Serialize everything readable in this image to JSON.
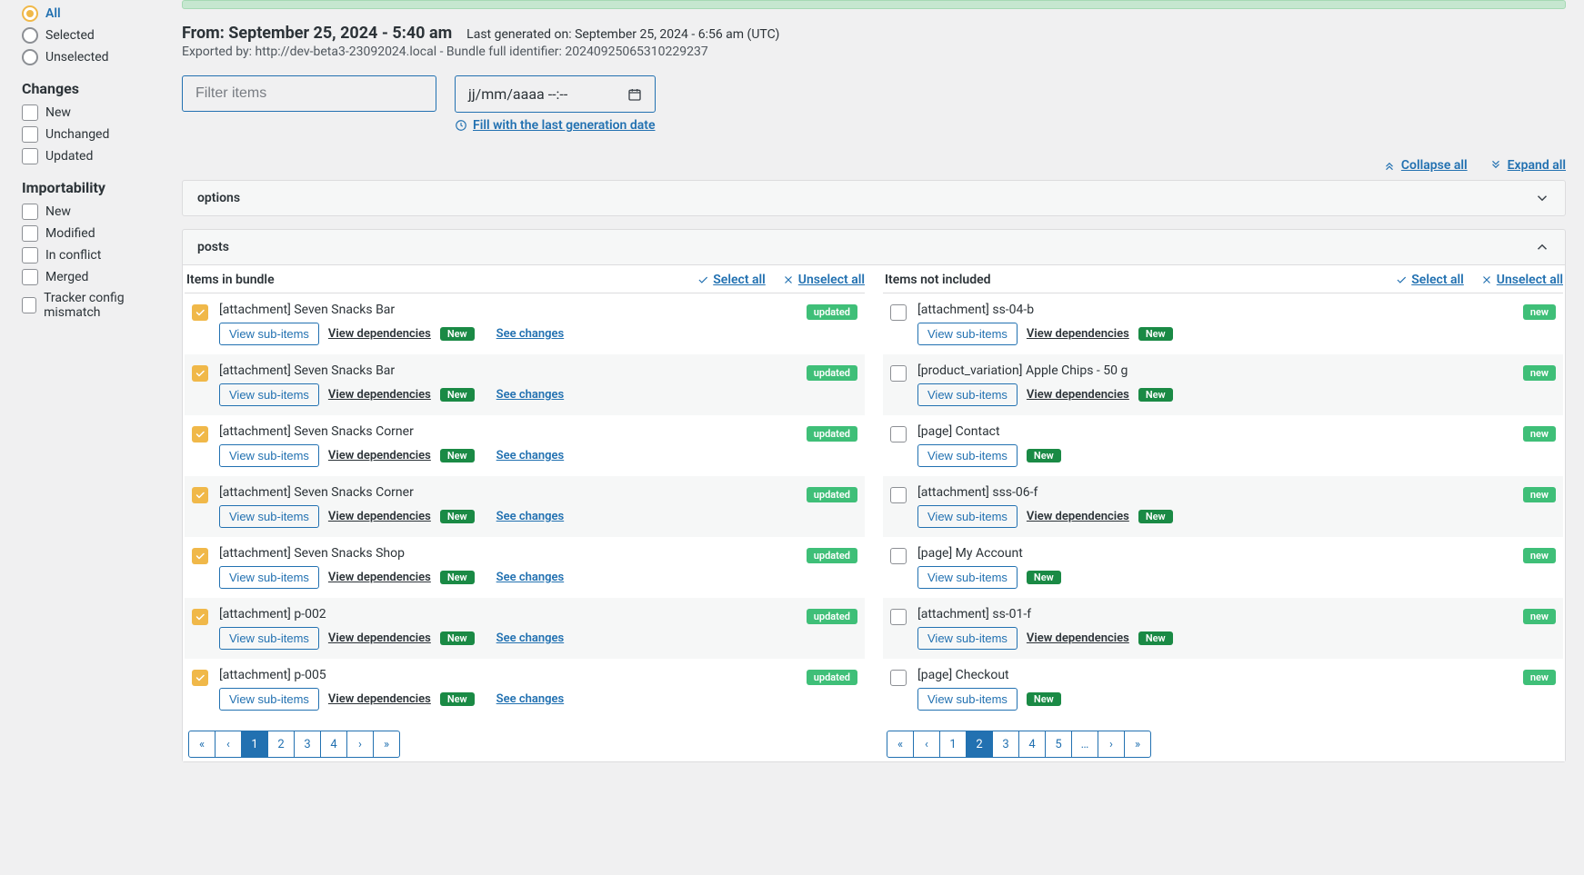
{
  "sidebar": {
    "selection_heading_hidden": true,
    "selection": {
      "options": [
        {
          "label": "All",
          "selected": true
        },
        {
          "label": "Selected",
          "selected": false
        },
        {
          "label": "Unselected",
          "selected": false
        }
      ]
    },
    "changes": {
      "heading": "Changes",
      "options": [
        "New",
        "Unchanged",
        "Updated"
      ]
    },
    "importability": {
      "heading": "Importability",
      "options": [
        "New",
        "Modified",
        "In conflict",
        "Merged",
        "Tracker config mismatch"
      ]
    }
  },
  "meta": {
    "from_label": "From: September 25, 2024 - 5:40 am",
    "lastgen": "Last generated on: September 25, 2024 - 6:56 am (UTC)",
    "exported": "Exported by: http://dev-beta3-23092024.local - Bundle full identifier: 20240925065310229237"
  },
  "filters": {
    "filter_placeholder": "Filter items",
    "date_placeholder": "jj/mm/aaaa --:--",
    "fill_link": "Fill with the last generation date"
  },
  "toolbar": {
    "collapse": "Collapse all",
    "expand": "Expand all"
  },
  "panels": {
    "options": {
      "title": "options"
    },
    "posts": {
      "title": "posts"
    }
  },
  "labels": {
    "items_in_bundle": "Items in bundle",
    "items_not_included": "Items not included",
    "select_all": "Select all",
    "unselect_all": "Unselect all",
    "view_sub": "View sub-items",
    "view_deps": "View dependencies",
    "see_changes": "See changes",
    "new": "New",
    "updated": "updated",
    "new_badge": "new"
  },
  "left_items": [
    {
      "title": "[attachment] Seven Snacks Bar",
      "checked": true,
      "status": "updated",
      "deps": true,
      "changes": true
    },
    {
      "title": "[attachment] Seven Snacks Bar",
      "checked": true,
      "status": "updated",
      "deps": true,
      "changes": true
    },
    {
      "title": "[attachment] Seven Snacks Corner",
      "checked": true,
      "status": "updated",
      "deps": true,
      "changes": true
    },
    {
      "title": "[attachment] Seven Snacks Corner",
      "checked": true,
      "status": "updated",
      "deps": true,
      "changes": true
    },
    {
      "title": "[attachment] Seven Snacks Shop",
      "checked": true,
      "status": "updated",
      "deps": true,
      "changes": true
    },
    {
      "title": "[attachment] p-002",
      "checked": true,
      "status": "updated",
      "deps": true,
      "changes": true
    },
    {
      "title": "[attachment] p-005",
      "checked": true,
      "status": "updated",
      "deps": true,
      "changes": true
    }
  ],
  "right_items": [
    {
      "title": "[attachment] ss-04-b",
      "checked": false,
      "status": "new",
      "deps": true,
      "changes": false
    },
    {
      "title": "[product_variation] Apple Chips - 50 g",
      "checked": false,
      "status": "new",
      "deps": true,
      "changes": false
    },
    {
      "title": "[page] Contact",
      "checked": false,
      "status": "new",
      "deps": false,
      "changes": false
    },
    {
      "title": "[attachment] sss-06-f",
      "checked": false,
      "status": "new",
      "deps": true,
      "changes": false
    },
    {
      "title": "[page] My Account",
      "checked": false,
      "status": "new",
      "deps": false,
      "changes": false
    },
    {
      "title": "[attachment] ss-01-f",
      "checked": false,
      "status": "new",
      "deps": true,
      "changes": false
    },
    {
      "title": "[page] Checkout",
      "checked": false,
      "status": "new",
      "deps": false,
      "changes": false
    }
  ],
  "pagination_left": [
    "«",
    "‹",
    "1",
    "2",
    "3",
    "4",
    "›",
    "»"
  ],
  "pagination_left_active": "1",
  "pagination_right": [
    "«",
    "‹",
    "1",
    "2",
    "3",
    "4",
    "5",
    "…",
    "›",
    "»"
  ],
  "pagination_right_active": "2"
}
